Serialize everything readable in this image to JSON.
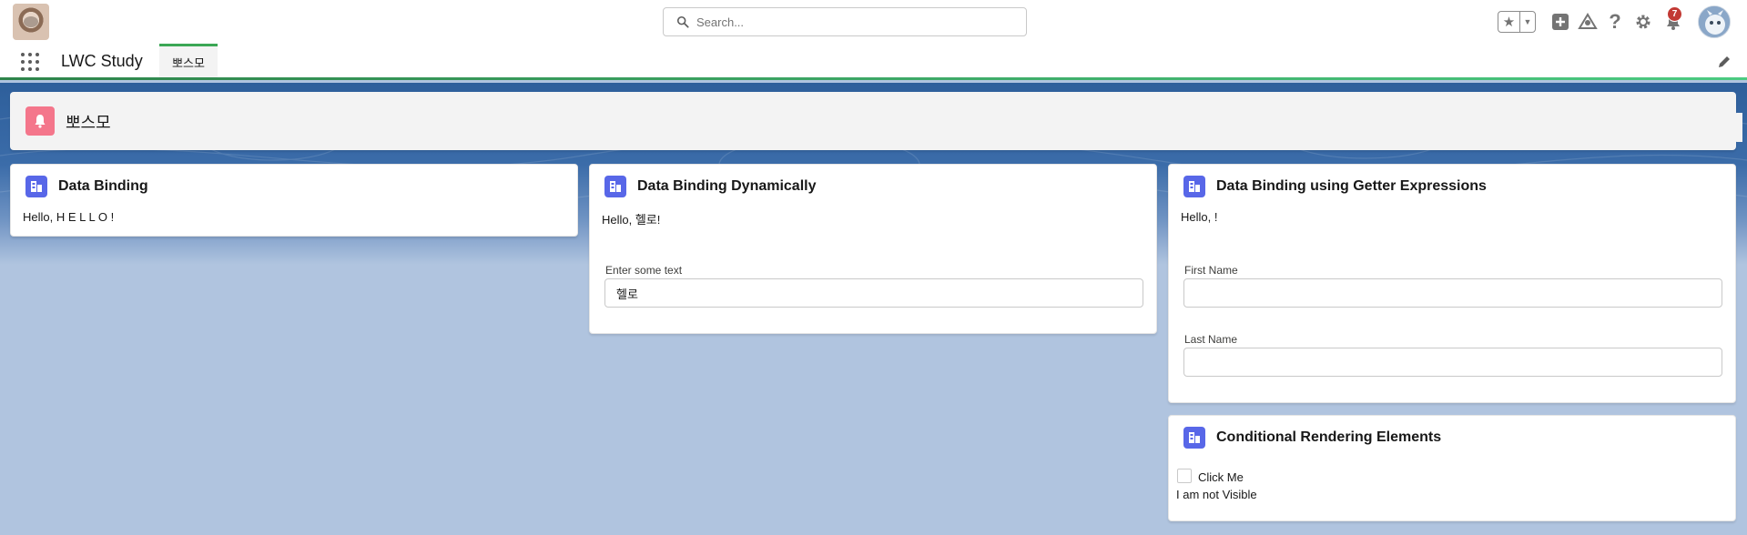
{
  "header": {
    "search_placeholder": "Search...",
    "notification_count": "7"
  },
  "app_bar": {
    "app_name": "LWC Study",
    "tab_label": "뽀스모"
  },
  "page_header": {
    "title": "뽀스모"
  },
  "cards": {
    "data_binding": {
      "title": "Data Binding",
      "text": "Hello, H E L L O !"
    },
    "data_binding_dynamic": {
      "title": "Data Binding Dynamically",
      "text": "Hello, 헬로!",
      "input_label": "Enter some text",
      "input_value": "헬로"
    },
    "getter": {
      "title": "Data Binding using Getter Expressions",
      "text": "Hello, !",
      "first_name_label": "First Name",
      "first_name_value": "",
      "last_name_label": "Last Name",
      "last_name_value": ""
    },
    "conditional": {
      "title": "Conditional Rendering Elements",
      "checkbox_label": "Click Me",
      "text": "I am not Visible"
    }
  },
  "colors": {
    "brand_blue": "#2e5f9b",
    "page_icon": "#f4768b",
    "card_icon": "#5867e8",
    "badge": "#c23934",
    "app_bar_accent": "#4bca81"
  }
}
